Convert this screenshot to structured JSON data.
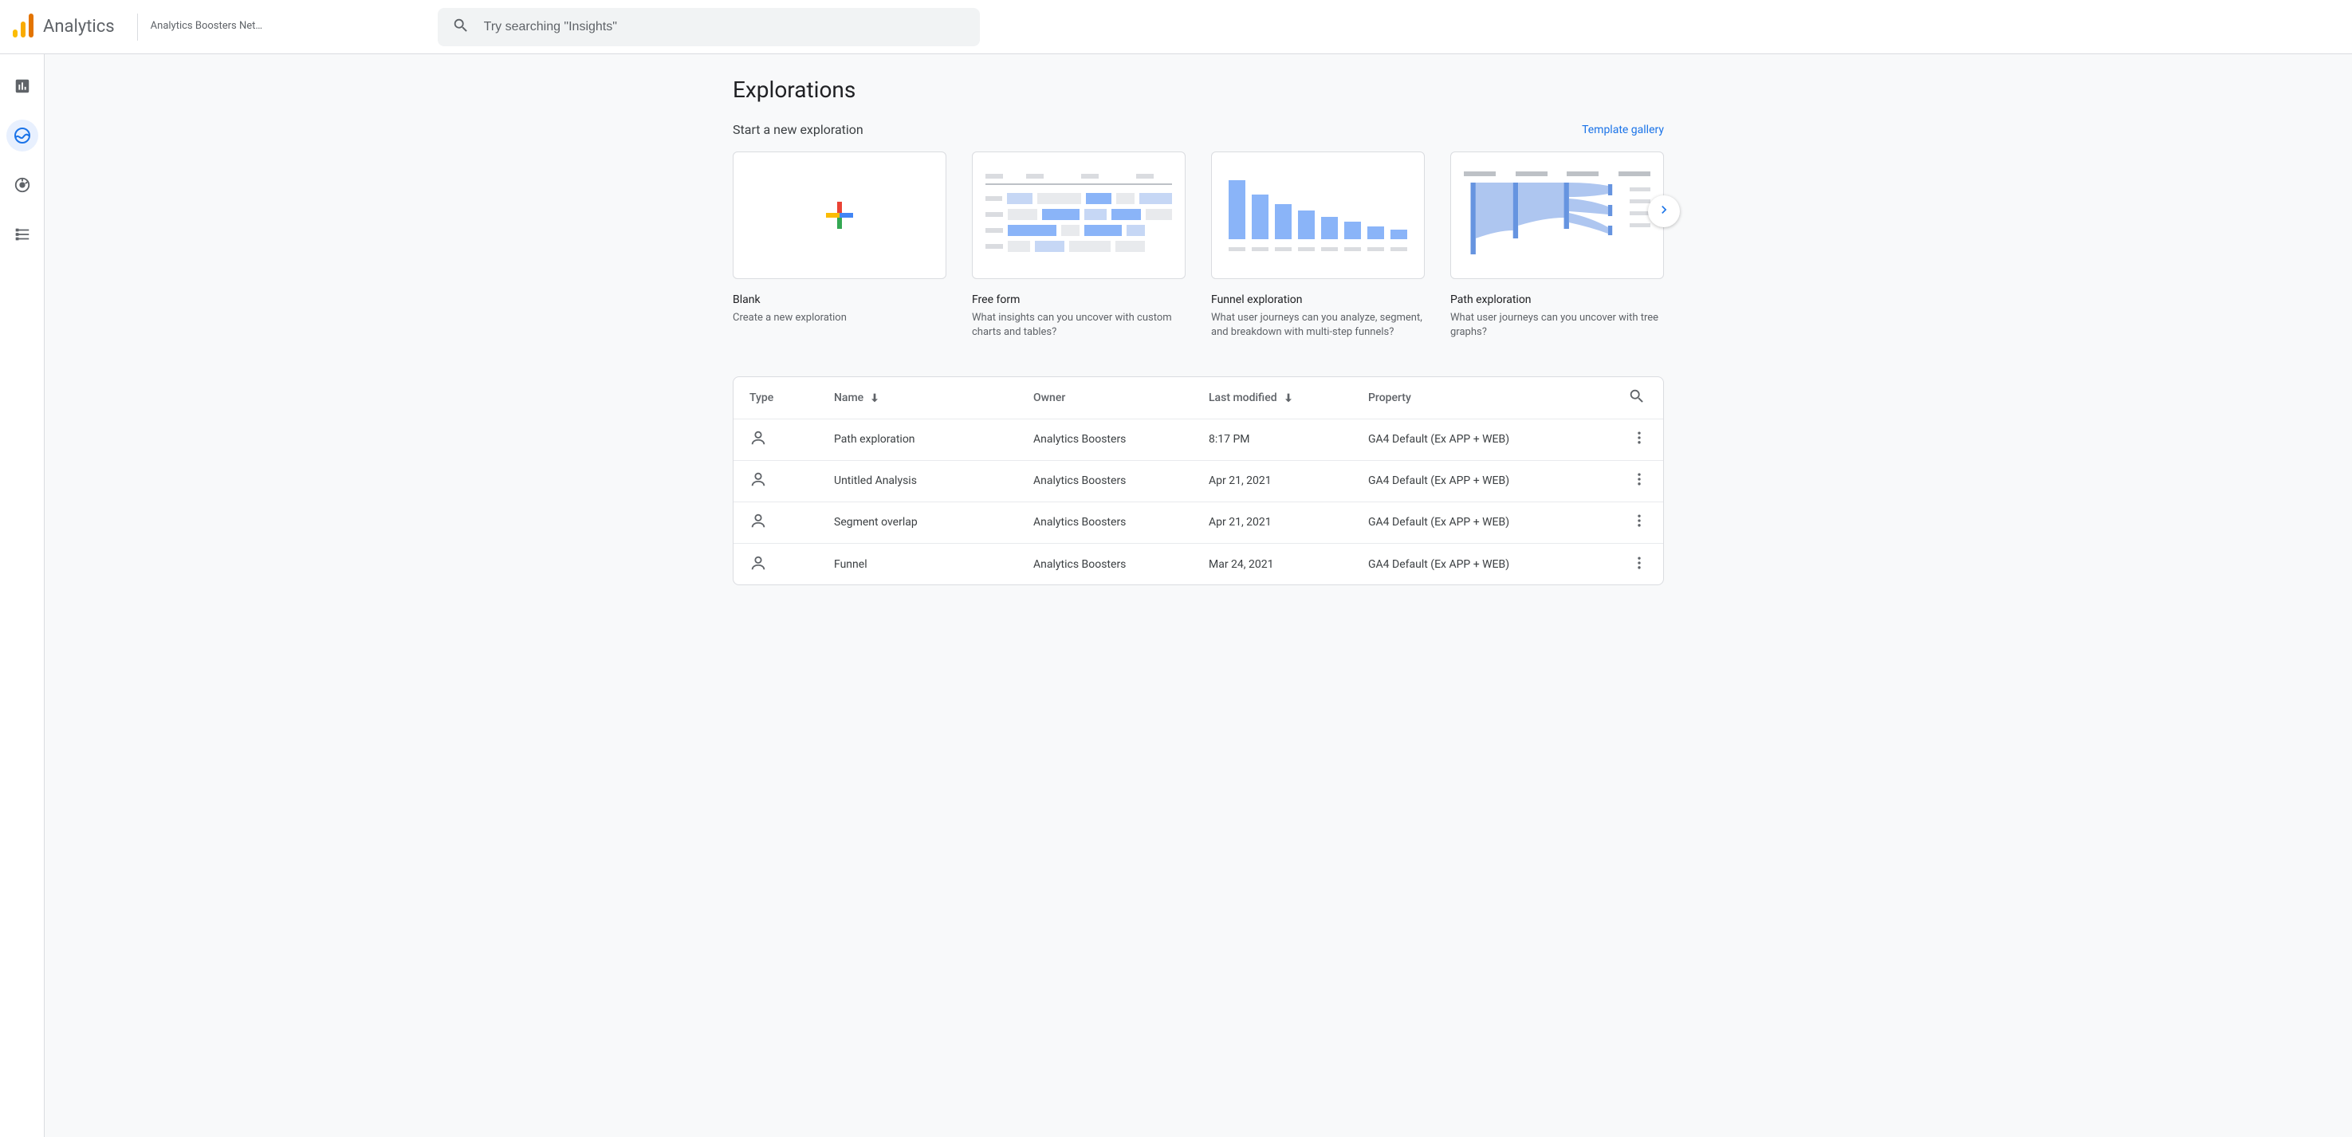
{
  "header": {
    "product": "Analytics",
    "account": "Analytics Boosters Net…",
    "search_placeholder": "Try searching \"Insights\""
  },
  "page": {
    "title": "Explorations",
    "subtitle": "Start a new exploration",
    "gallery_link": "Template gallery"
  },
  "templates": [
    {
      "title": "Blank",
      "desc": "Create a new exploration"
    },
    {
      "title": "Free form",
      "desc": "What insights can you uncover with custom charts and tables?"
    },
    {
      "title": "Funnel exploration",
      "desc": "What user journeys can you analyze, segment, and breakdown with multi-step funnels?"
    },
    {
      "title": "Path exploration",
      "desc": "What user journeys can you uncover with tree graphs?"
    }
  ],
  "table": {
    "headers": {
      "type": "Type",
      "name": "Name",
      "owner": "Owner",
      "modified": "Last modified",
      "property": "Property"
    },
    "rows": [
      {
        "name": "Path exploration",
        "owner": "Analytics Boosters",
        "modified": "8:17 PM",
        "property": "GA4 Default (Ex APP + WEB)"
      },
      {
        "name": "Untitled Analysis",
        "owner": "Analytics Boosters",
        "modified": "Apr 21, 2021",
        "property": "GA4 Default (Ex APP + WEB)"
      },
      {
        "name": "Segment overlap",
        "owner": "Analytics Boosters",
        "modified": "Apr 21, 2021",
        "property": "GA4 Default (Ex APP + WEB)"
      },
      {
        "name": "Funnel",
        "owner": "Analytics Boosters",
        "modified": "Mar 24, 2021",
        "property": "GA4 Default (Ex APP + WEB)"
      }
    ]
  }
}
